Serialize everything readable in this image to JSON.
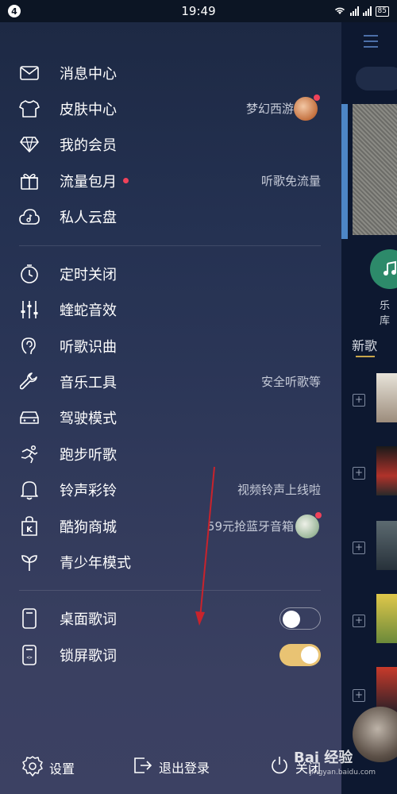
{
  "status_bar": {
    "notification_count": "4",
    "time": "19:49",
    "battery": "85"
  },
  "menu_group1": [
    {
      "label": "消息中心",
      "icon": "mail-icon",
      "hint": ""
    },
    {
      "label": "皮肤中心",
      "icon": "shirt-icon",
      "hint": "梦幻西游"
    },
    {
      "label": "我的会员",
      "icon": "diamond-icon",
      "hint": ""
    },
    {
      "label": "流量包月",
      "icon": "gift-icon",
      "hint": "听歌免流量"
    },
    {
      "label": "私人云盘",
      "icon": "cloud-music-icon",
      "hint": ""
    }
  ],
  "menu_group2": [
    {
      "label": "定时关闭",
      "icon": "timer-icon",
      "hint": ""
    },
    {
      "label": "蝰蛇音效",
      "icon": "equalizer-icon",
      "hint": ""
    },
    {
      "label": "听歌识曲",
      "icon": "song-recognition-icon",
      "hint": ""
    },
    {
      "label": "音乐工具",
      "icon": "wrench-icon",
      "hint": "安全听歌等"
    },
    {
      "label": "驾驶模式",
      "icon": "car-icon",
      "hint": ""
    },
    {
      "label": "跑步听歌",
      "icon": "running-icon",
      "hint": ""
    },
    {
      "label": "铃声彩铃",
      "icon": "bell-icon",
      "hint": "视频铃声上线啦"
    },
    {
      "label": "酷狗商城",
      "icon": "shop-bag-icon",
      "hint": "59元抢蓝牙音箱"
    },
    {
      "label": "青少年模式",
      "icon": "sprout-icon",
      "hint": ""
    }
  ],
  "lyrics": {
    "desktop": {
      "label": "桌面歌词",
      "icon": "desktop-lyrics-icon",
      "enabled": false
    },
    "lockscreen": {
      "label": "锁屏歌词",
      "icon": "lockscreen-lyrics-icon",
      "enabled": true
    }
  },
  "bottom_bar": {
    "settings": "设置",
    "logout": "退出登录",
    "close": "关闭"
  },
  "background": {
    "green_label": "乐库",
    "new_songs": "新歌"
  },
  "watermark": {
    "text": "Bai 经验",
    "sub": "jingyan.baidu.com"
  },
  "colors": {
    "accent_toggle": "#e9c373",
    "red_dot": "#f0425a",
    "highlight": "#c8232c"
  }
}
